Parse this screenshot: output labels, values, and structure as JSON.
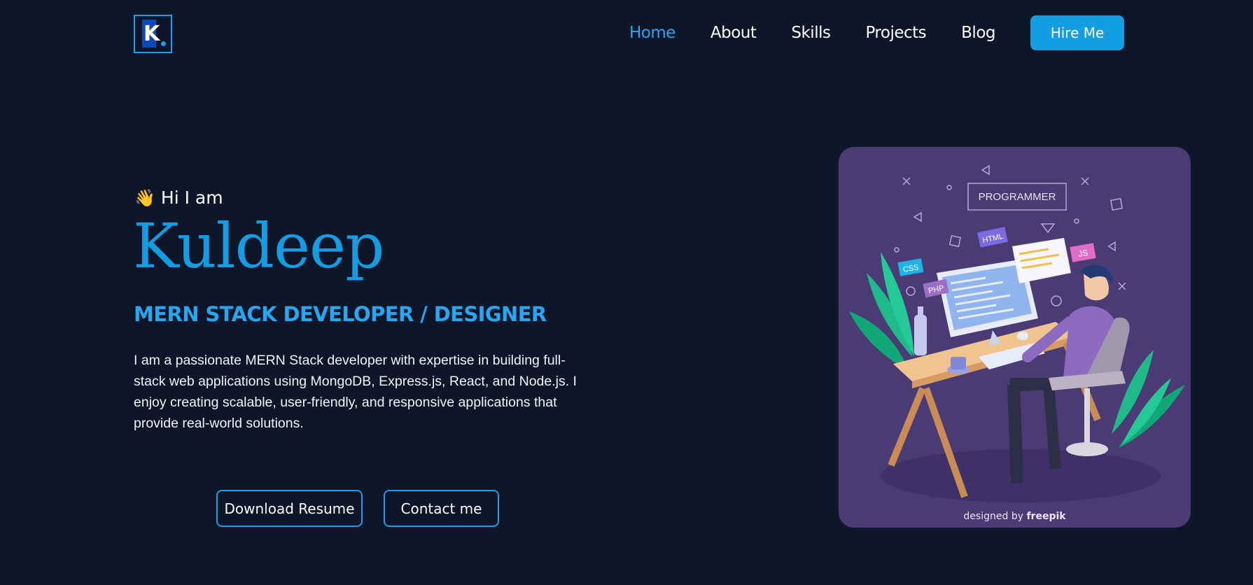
{
  "header": {
    "logo_letter": "K",
    "nav": [
      "Home",
      "About",
      "Skills",
      "Projects",
      "Blog"
    ],
    "hire_label": "Hire Me"
  },
  "hero": {
    "greeting": "Hi I am",
    "name": "Kuldeep",
    "role": "MERN STACK DEVELOPER / DESIGNER",
    "bio": "I am a passionate MERN Stack developer with expertise in building full-stack web applications using MongoDB, Express.js, React, and Node.js. I enjoy creating scalable, user-friendly, and responsive applications that provide real-world solutions.",
    "resume_label": "Download Resume",
    "contact_label": "Contact me"
  },
  "illustration": {
    "sign": "PROGRAMMER",
    "tags": [
      "HTML",
      "CSS",
      "PHP",
      "JS"
    ],
    "credit_prefix": "designed by",
    "credit_brand": "freepik"
  },
  "colors": {
    "background": "#0e1629",
    "accent": "#139ee3",
    "card": "#4b3b75"
  }
}
